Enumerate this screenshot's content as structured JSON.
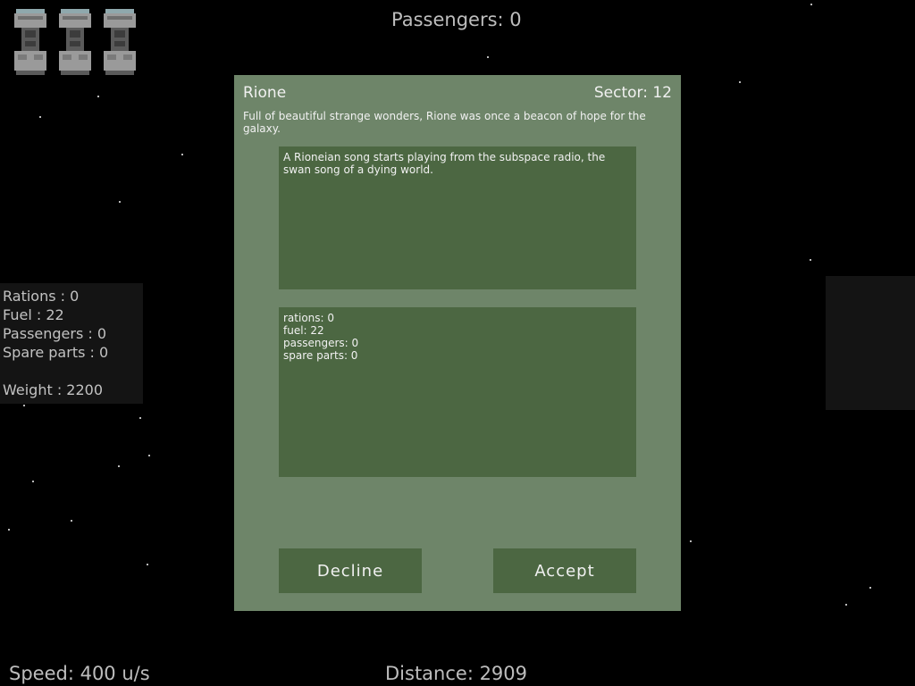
{
  "hud": {
    "passengers": "Passengers: 0",
    "speed": "Speed: 400 u/s",
    "distance": "Distance: 2909"
  },
  "stats": {
    "rations": "Rations : 0",
    "fuel": "Fuel : 22",
    "passengers": "Passengers : 0",
    "spare_parts": "Spare parts : 0",
    "weight": "Weight : 2200"
  },
  "dialog": {
    "title": "Rione",
    "sector": "Sector: 12",
    "description": "Full of beautiful strange wonders, Rione was once a beacon of hope for the galaxy.",
    "event_text": "A Rioneian song starts playing from the subspace radio, the swan song of a dying world.",
    "resources": [
      "rations: 0",
      "fuel: 22",
      "passengers: 0",
      "spare parts: 0"
    ],
    "decline_label": "Decline",
    "accept_label": "Accept"
  },
  "icons": {
    "ship_count": 3,
    "ship_icon": "rocket-ship-icon"
  },
  "colors": {
    "background": "#000000",
    "dialog": "#6e8569",
    "panel": "#4c6742",
    "hud_text": "#bdbdbd"
  }
}
